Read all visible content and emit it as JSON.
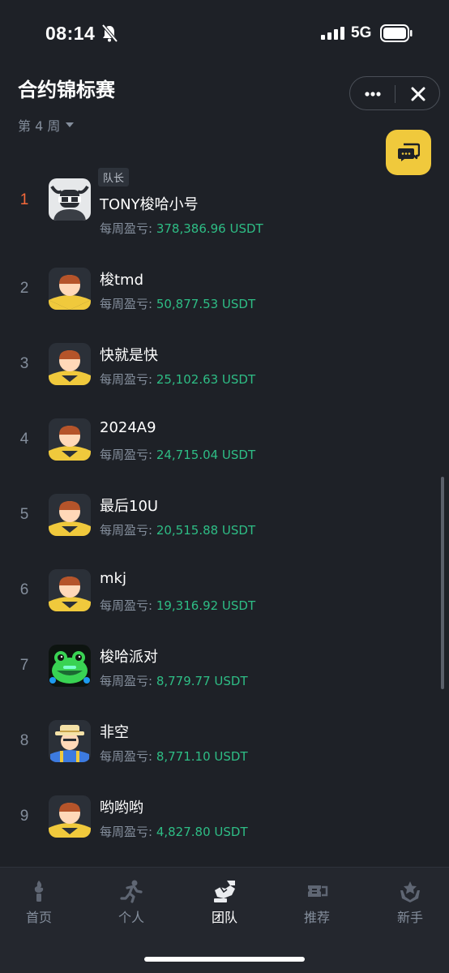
{
  "status_bar": {
    "time": "08:14",
    "network": "5G"
  },
  "header": {
    "title": "合约锦标赛",
    "week_label": "第 4 周"
  },
  "captain_badge": "队长",
  "pnl_label": "每周盈亏: ",
  "leaderboard": [
    {
      "rank": "1",
      "name": "TONY梭哈小号",
      "pnl": "378,386.96 USDT",
      "avatar": "bull"
    },
    {
      "rank": "2",
      "name": "梭tmd",
      "pnl": "50,877.53 USDT",
      "avatar": "default"
    },
    {
      "rank": "3",
      "name": "快就是快",
      "pnl": "25,102.63 USDT",
      "avatar": "default"
    },
    {
      "rank": "4",
      "name": "2024A9",
      "pnl": "24,715.04 USDT",
      "avatar": "default"
    },
    {
      "rank": "5",
      "name": "最后10U",
      "pnl": "20,515.88 USDT",
      "avatar": "default"
    },
    {
      "rank": "6",
      "name": "mkj",
      "pnl": "19,316.92 USDT",
      "avatar": "default"
    },
    {
      "rank": "7",
      "name": "梭哈派对",
      "pnl": "8,779.77 USDT",
      "avatar": "frog"
    },
    {
      "rank": "8",
      "name": "非空",
      "pnl": "8,771.10 USDT",
      "avatar": "farmer"
    },
    {
      "rank": "9",
      "name": "哟哟哟",
      "pnl": "4,827.80 USDT",
      "avatar": "default"
    }
  ],
  "bottom_nav": [
    {
      "label": "首页",
      "icon": "torch-icon",
      "active": false
    },
    {
      "label": "个人",
      "icon": "runner-icon",
      "active": false
    },
    {
      "label": "团队",
      "icon": "team-handshake-icon",
      "active": true
    },
    {
      "label": "推荐",
      "icon": "ticket-icon",
      "active": false
    },
    {
      "label": "新手",
      "icon": "star-hands-icon",
      "active": false
    }
  ],
  "colors": {
    "background": "#1e2127",
    "accent_yellow": "#f0c93c",
    "profit_green": "#2ebd85",
    "top_rank": "#f6693a",
    "muted": "#848e9c"
  }
}
